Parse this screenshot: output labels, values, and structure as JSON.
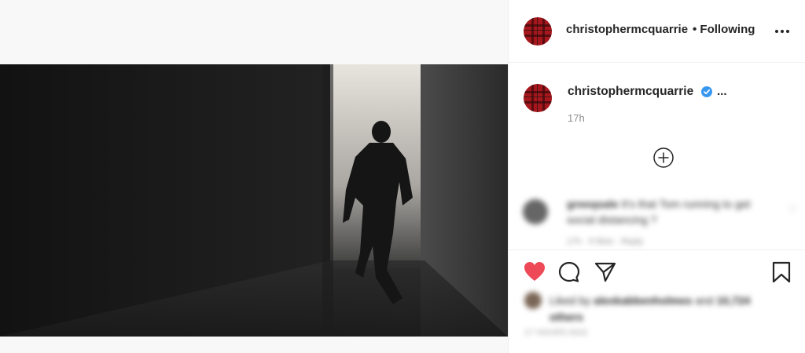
{
  "header": {
    "username": "christophermcquarrie",
    "follow_status": "• Following",
    "more_icon": "more-horizontal-icon"
  },
  "caption": {
    "username": "christophermcquarrie",
    "verified_icon": "verified-badge-icon",
    "ellipsis": "...",
    "time": "17h",
    "load_more_icon": "plus-circle-icon"
  },
  "comment": {
    "username": "greeqsale",
    "text": "It's that Tom running to get social distancing ?",
    "meta": "17h  ·  9 likes  ·  Reply"
  },
  "actions": {
    "like_icon": "heart-filled-icon",
    "comment_icon": "comment-icon",
    "share_icon": "send-icon",
    "save_icon": "bookmark-icon",
    "like_color": "#ed4956"
  },
  "likes": {
    "prefix": "Liked by",
    "liker": "alexkabbenholmes",
    "conj": "and",
    "count": "10,724 others"
  },
  "post_date": "17 HOURS AGO",
  "colors": {
    "avatar_red": "#a5171d",
    "verified_blue": "#3897f0"
  }
}
